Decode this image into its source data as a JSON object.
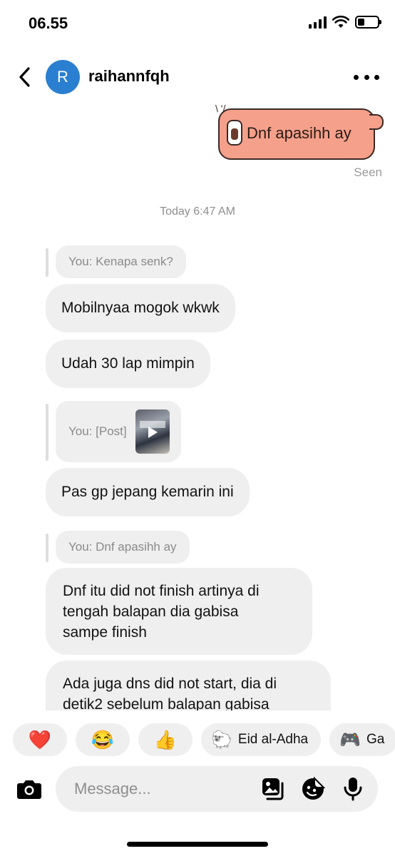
{
  "status_bar": {
    "time": "06.55",
    "battery_level": 0.35
  },
  "header": {
    "avatar_initial": "R",
    "username": "raihannfqh"
  },
  "sticker_message": {
    "text": "Dnf apasihh ay",
    "status": "Seen"
  },
  "timestamp": "Today 6:47 AM",
  "messages": [
    {
      "reply": "You: Kenapa senk?"
    },
    {
      "text": "Mobilnyaa mogok wkwk"
    },
    {
      "text": "Udah 30 lap mimpin"
    },
    {
      "reply": "You: [Post]"
    },
    {
      "text": "Pas gp jepang kemarin ini"
    },
    {
      "reply": "You: Dnf apasihh ay"
    },
    {
      "text_lines": [
        "Dnf itu did not finish artinya di",
        "tengah balapan dia gabisa",
        "sampe finish"
      ]
    },
    {
      "text_lines": [
        "Ada juga dns did not start, dia di",
        "detik2 sebelum balapan gabisa"
      ]
    }
  ],
  "reactions": [
    {
      "emoji": "❤️"
    },
    {
      "emoji": "😂"
    },
    {
      "emoji": "👍"
    },
    {
      "emoji": "🐑",
      "label": "Eid al-Adha"
    },
    {
      "emoji": "🎮",
      "label": "Ga"
    }
  ],
  "composer": {
    "placeholder": "Message..."
  },
  "icons": {
    "back": "chevron-left-icon",
    "more": "more-horizontal-icon",
    "camera": "camera-icon",
    "gallery": "gallery-icon",
    "sticker": "sticker-icon",
    "microphone": "microphone-icon"
  },
  "colors": {
    "avatar": "#2b7fd0",
    "sticker_bubble": "#f5a08b",
    "bubble_gray": "#efefef"
  }
}
